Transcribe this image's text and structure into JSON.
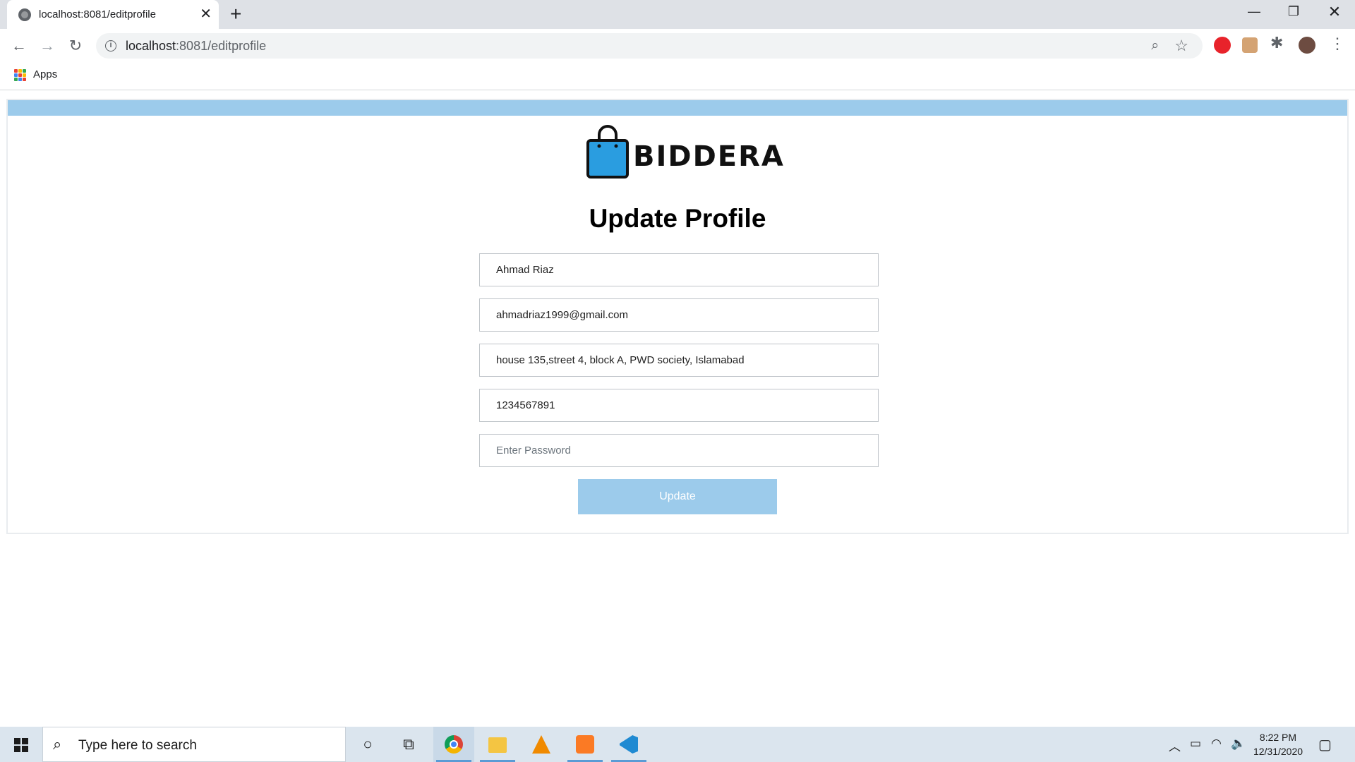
{
  "browser": {
    "tab_title": "localhost:8081/editprofile",
    "url_host": "localhost",
    "url_rest": ":8081/editprofile",
    "bookmarks_apps_label": "Apps"
  },
  "logo": {
    "brand_text": "BIDDERA"
  },
  "page": {
    "title": "Update Profile",
    "fields": {
      "name_value": "Ahmad Riaz",
      "email_value": "ahmadriaz1999@gmail.com",
      "address_value": "house 135,street 4, block A, PWD society, Islamabad",
      "phone_value": "1234567891",
      "password_placeholder": "Enter Password"
    },
    "submit_label": "Update"
  },
  "taskbar": {
    "search_placeholder": "Type here to search",
    "time": "8:22 PM",
    "date": "12/31/2020"
  },
  "colors": {
    "accent": "#9ccbeb",
    "logo_bag": "#2a9de0"
  }
}
